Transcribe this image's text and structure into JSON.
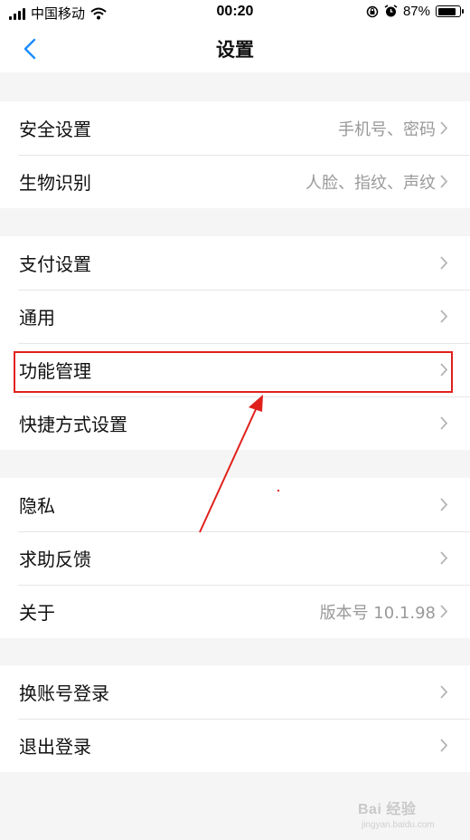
{
  "status_bar": {
    "carrier": "中国移动",
    "time": "00:20",
    "battery": "87%",
    "battery_level": 0.87
  },
  "header": {
    "title": "设置"
  },
  "groups": [
    {
      "items": [
        {
          "label": "安全设置",
          "value": "手机号、密码"
        },
        {
          "label": "生物识别",
          "value": "人脸、指纹、声纹"
        }
      ]
    },
    {
      "items": [
        {
          "label": "支付设置",
          "value": ""
        },
        {
          "label": "通用",
          "value": ""
        },
        {
          "label": "功能管理",
          "value": ""
        },
        {
          "label": "快捷方式设置",
          "value": ""
        }
      ]
    },
    {
      "items": [
        {
          "label": "隐私",
          "value": ""
        },
        {
          "label": "求助反馈",
          "value": ""
        },
        {
          "label": "关于",
          "value": "版本号 10.1.98"
        }
      ]
    },
    {
      "items": [
        {
          "label": "换账号登录",
          "value": ""
        },
        {
          "label": "退出登录",
          "value": ""
        }
      ]
    }
  ],
  "colors": {
    "accent": "#1a8cff",
    "annotation": "#e0201c",
    "background": "#f5f5f5"
  },
  "icons": [
    "signal-icon",
    "wifi-icon",
    "lock-rotation-icon",
    "alarm-icon",
    "battery-icon",
    "back-icon",
    "chevron-right-icon",
    "annotation-arrow"
  ],
  "watermark": {
    "text": "Bai 经验",
    "sub": "jingyan.baidu.com"
  }
}
